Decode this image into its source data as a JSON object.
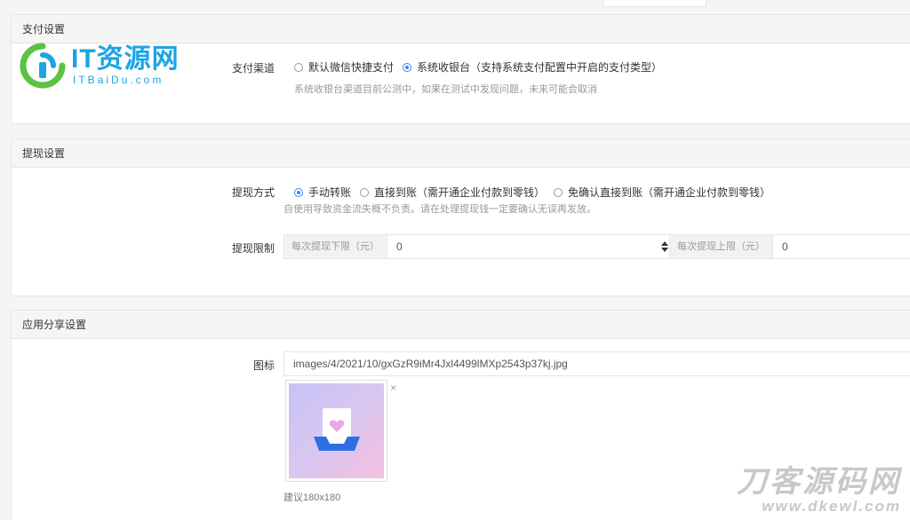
{
  "top_tab": {
    "label": ""
  },
  "payment": {
    "heading": "支付设置",
    "channel_label": "支付渠道",
    "options": [
      "默认微信快捷支付",
      "系统收银台（支持系统支付配置中开启的支付类型）"
    ],
    "selected": 1,
    "help": "系统收银台渠道目前公测中，如果在测试中发现问题，未来可能会取消"
  },
  "withdraw": {
    "heading": "提现设置",
    "method_label": "提现方式",
    "options": [
      "手动转账",
      "直接到账（需开通企业付款到零钱）",
      "免确认直接到账（需开通企业付款到零钱）"
    ],
    "selected": 0,
    "help": "自使用导致资金流失概不负责。请在处理提现钱一定要确认无误再发放。",
    "limit_label": "提现限制",
    "min_addon": "每次提现下限（元）",
    "min_value": "0",
    "max_addon": "每次提现上限（元）",
    "max_value": "0"
  },
  "share": {
    "heading": "应用分享设置",
    "icon_label": "图标",
    "icon_path": "images/4/2021/10/gxGzR9iMr4Jxl4499lMXp2543p37kj.jpg",
    "close": "×",
    "hint": "建议180x180"
  },
  "logo": {
    "title": "IT资源网",
    "subtitle": "ITBaiDu.com"
  },
  "watermark": {
    "title": "刀客源码网",
    "url": "www.dkewl.com"
  },
  "colors": {
    "accent": "#3b87f0",
    "logo": "#1ca4e6",
    "logo_green": "#5ac341"
  }
}
